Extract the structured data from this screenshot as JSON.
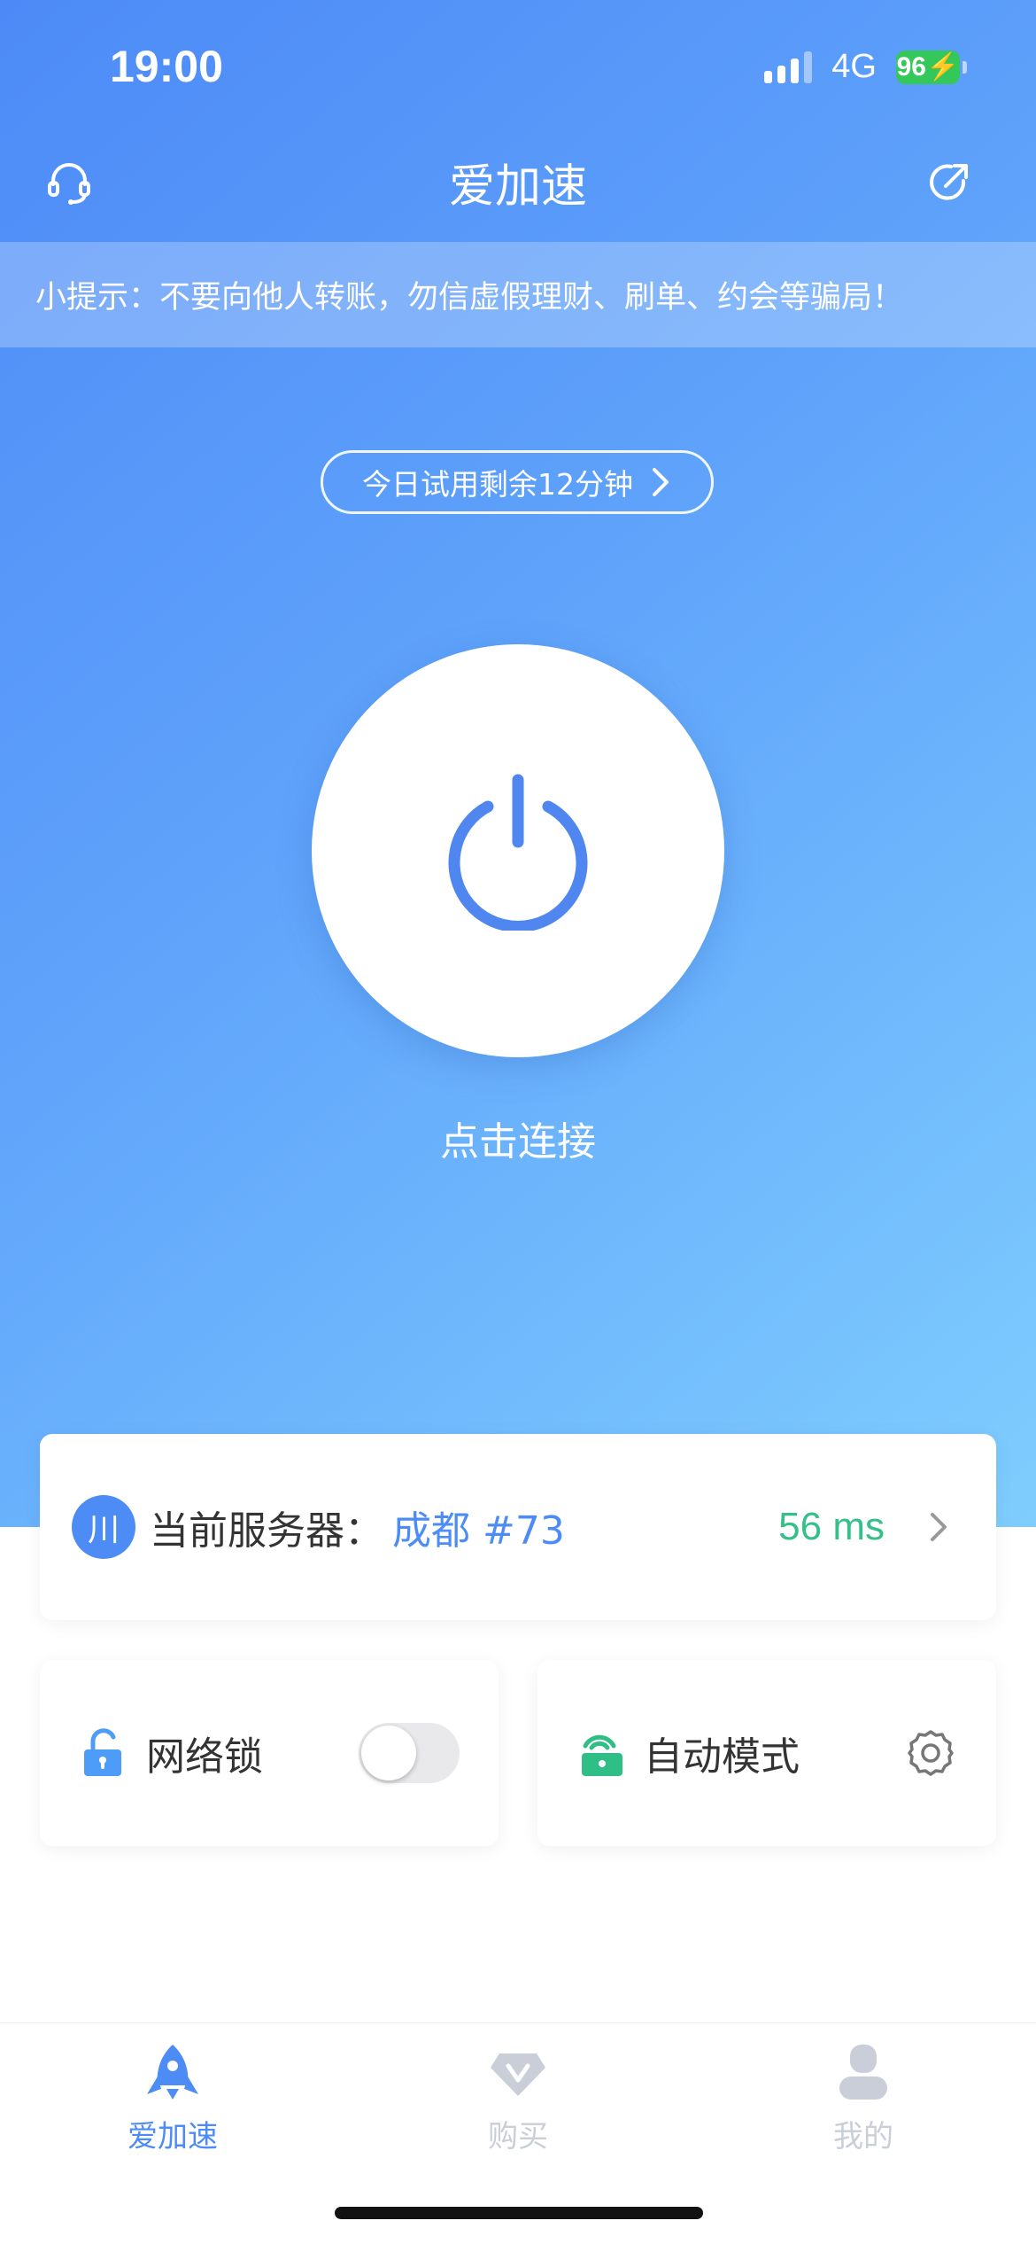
{
  "status_bar": {
    "time": "19:00",
    "network": "4G",
    "battery": "96"
  },
  "header": {
    "title": "爱加速",
    "left_icon": "headset-support-icon",
    "right_icon": "share-external-icon"
  },
  "tip": {
    "text": "小提示：不要向他人转账，勿信虚假理财、刷单、约会等骗局！"
  },
  "trial": {
    "label": "今日试用剩余12分钟"
  },
  "power": {
    "icon": "power-icon",
    "label": "点击连接"
  },
  "server": {
    "badge": "川",
    "label": "当前服务器：",
    "name": "成都 #73",
    "ping": "56 ms"
  },
  "network_lock": {
    "label": "网络锁",
    "enabled": false
  },
  "auto_mode": {
    "label": "自动模式"
  },
  "bottom_nav": {
    "items": [
      {
        "label": "爱加速",
        "icon": "rocket-icon",
        "active": true
      },
      {
        "label": "购买",
        "icon": "diamond-icon",
        "active": false
      },
      {
        "label": "我的",
        "icon": "user-icon",
        "active": false
      }
    ]
  },
  "colors": {
    "accent": "#4d8cf5",
    "ping_green": "#35c08a",
    "inactive": "#c9ced8"
  }
}
